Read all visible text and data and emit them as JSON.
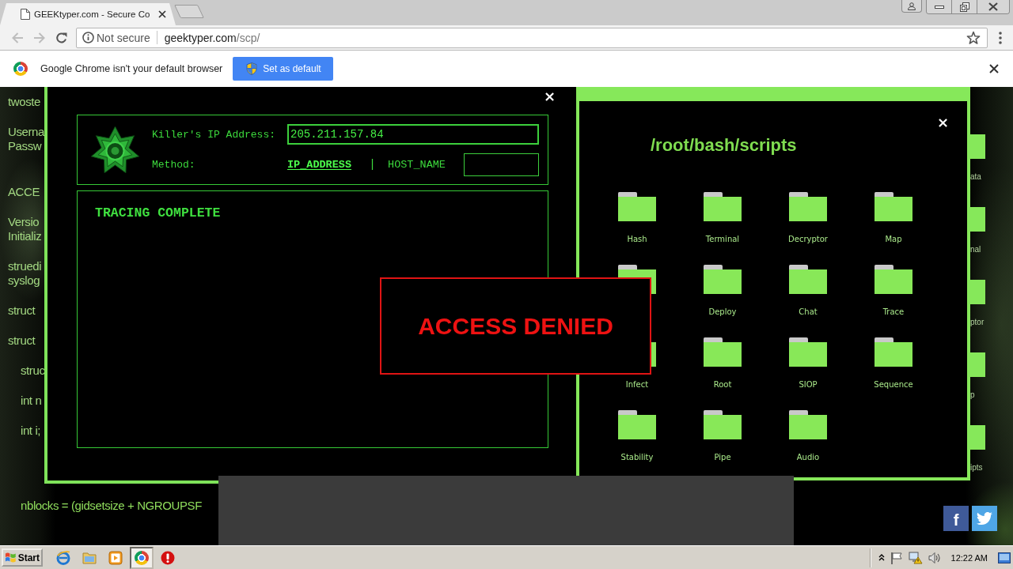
{
  "browser": {
    "tab": {
      "title": "GEEKtyper.com - Secure Co",
      "selected": true
    },
    "address_bar": {
      "security": "Not secure",
      "host": "geektyper.com",
      "path": "/scp/"
    }
  },
  "infobar": {
    "message": "Google Chrome isn't your default browser",
    "button": "Set as default"
  },
  "background_code": [
    {
      "kind": "text",
      "lines": [
        "twoste"
      ]
    },
    {
      "kind": "text",
      "lines": [
        "Userna",
        "Passw"
      ]
    },
    {
      "kind": "status",
      "lines": [
        "ACCE"
      ]
    },
    {
      "kind": "text",
      "lines": [
        "Versio",
        "Initializ"
      ]
    },
    {
      "kind": "text",
      "lines": [
        "struedi",
        "syslog"
      ]
    },
    {
      "kind": "text",
      "lines": [
        "struct"
      ]
    },
    {
      "kind": "text",
      "lines": [
        "struct"
      ],
      "children": [
        {
          "kind": "text",
          "lines": [
            "struc"
          ]
        },
        {
          "kind": "text",
          "lines": [
            "int n"
          ]
        },
        {
          "kind": "text",
          "lines": [
            "int i;"
          ]
        },
        {
          "kind": "text",
          "lines": [
            "nblocks = (gidsetsize + NGROUPSF"
          ]
        }
      ]
    }
  ],
  "background_icons": [
    {
      "label": "ata"
    },
    {
      "label": "nal"
    },
    {
      "label": "ptor"
    },
    {
      "label": "p"
    },
    {
      "label": "ipts"
    }
  ],
  "trace_window": {
    "close": "×",
    "ip_label": "Killer's IP Address:",
    "ip_value": "205.211.157.84",
    "method_label": "Method:",
    "methods": [
      {
        "label": "IP_ADDRESS",
        "selected": true
      },
      {
        "label": "HOST_NAME",
        "selected": false
      }
    ],
    "separator": "|",
    "status": "TRACING COMPLETE"
  },
  "scripts_window": {
    "close": "×",
    "title": "/root/bash/scripts",
    "folders": [
      {
        "kind": "folder",
        "label": "Hash"
      },
      {
        "kind": "folder",
        "label": "Terminal"
      },
      {
        "kind": "folder",
        "label": "Decryptor"
      },
      {
        "kind": "folder",
        "label": "Map"
      },
      {
        "kind": "folder"
      },
      {
        "kind": "folder",
        "label": "Deploy"
      },
      {
        "kind": "folder",
        "label": "Chat"
      },
      {
        "kind": "folder",
        "label": "Trace"
      },
      {
        "kind": "folder",
        "label": "Infect"
      },
      {
        "kind": "folder",
        "label": "Root"
      },
      {
        "kind": "folder",
        "label": "SIOP"
      },
      {
        "kind": "folder",
        "label": "Sequence"
      },
      {
        "kind": "folder",
        "label": "Stability"
      },
      {
        "kind": "folder",
        "label": "Pipe"
      },
      {
        "kind": "folder",
        "label": "Audio"
      }
    ]
  },
  "alert": {
    "message": "ACCESS DENIED"
  },
  "share_buttons": [
    {
      "kind": "facebook",
      "glyph": "f"
    },
    {
      "kind": "twitter"
    }
  ],
  "taskbar": {
    "start": "Start",
    "apps": [
      {
        "kind": "globe",
        "selected": false
      },
      {
        "kind": "folder",
        "selected": false
      },
      {
        "kind": "player",
        "selected": false
      },
      {
        "kind": "browser",
        "selected": true
      },
      {
        "kind": "stop",
        "selected": false
      }
    ],
    "clock": "12:22 AM"
  }
}
